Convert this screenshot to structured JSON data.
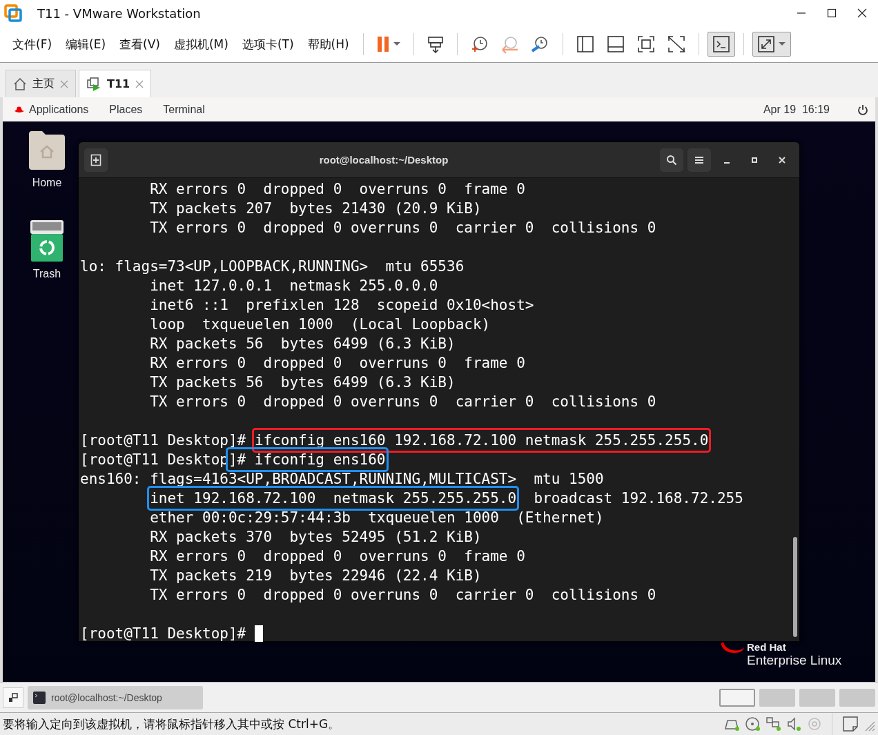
{
  "window": {
    "title": "T11 - VMware Workstation"
  },
  "menu": [
    "文件(F)",
    "编辑(E)",
    "查看(V)",
    "虚拟机(M)",
    "选项卡(T)",
    "帮助(H)"
  ],
  "tabs": [
    {
      "label": "主页",
      "kind": "home",
      "selected": false
    },
    {
      "label": "T11",
      "kind": "vm",
      "selected": true
    }
  ],
  "guest_top_bar": {
    "items": [
      "Applications",
      "Places",
      "Terminal"
    ],
    "clock": "Apr 19  16:19"
  },
  "desktop_icons": [
    {
      "label": "Home",
      "kind": "folder"
    },
    {
      "label": "Trash",
      "kind": "trash"
    }
  ],
  "branding": {
    "line_1": "Red Hat",
    "line_2": "Enterprise Linux"
  },
  "terminal": {
    "title": "root@localhost:~/Desktop",
    "lines": [
      {
        "segments": [
          {
            "text": "        RX errors 0  dropped 0  overruns 0  frame 0"
          }
        ]
      },
      {
        "segments": [
          {
            "text": "        TX packets 207  bytes 21430 (20.9 KiB)"
          }
        ]
      },
      {
        "segments": [
          {
            "text": "        TX errors 0  dropped 0 overruns 0  carrier 0  collisions 0"
          }
        ]
      },
      {
        "kind": "blank"
      },
      {
        "segments": [
          {
            "text": "lo: flags=73<UP,LOOPBACK,RUNNING>  mtu 65536"
          }
        ]
      },
      {
        "segments": [
          {
            "text": "        inet 127.0.0.1  netmask 255.0.0.0"
          }
        ]
      },
      {
        "segments": [
          {
            "text": "        inet6 ::1  prefixlen 128  scopeid 0x10<host>"
          }
        ]
      },
      {
        "segments": [
          {
            "text": "        loop  txqueuelen 1000  (Local Loopback)"
          }
        ]
      },
      {
        "segments": [
          {
            "text": "        RX packets 56  bytes 6499 (6.3 KiB)"
          }
        ]
      },
      {
        "segments": [
          {
            "text": "        RX errors 0  dropped 0  overruns 0  frame 0"
          }
        ]
      },
      {
        "segments": [
          {
            "text": "        TX packets 56  bytes 6499 (6.3 KiB)"
          }
        ]
      },
      {
        "segments": [
          {
            "text": "        TX errors 0  dropped 0 overruns 0  carrier 0  collisions 0"
          }
        ]
      },
      {
        "kind": "blank"
      },
      {
        "segments": [
          {
            "text": "[root@T11 Desktop]# "
          },
          {
            "text": "ifconfig ens160 192.168.72.100 netmask 255.255.255.0",
            "color": "#ee1c24"
          }
        ]
      },
      {
        "segments": [
          {
            "text": "[root@T11 Desktop"
          },
          {
            "text": "]# ifconfig ens160",
            "color": "#1f8ff0"
          }
        ]
      },
      {
        "segments": [
          {
            "text": "ens160: flags=4163<UP,BROADCAST,RUNNING,MULTICAST>  mtu 1500"
          }
        ]
      },
      {
        "indent": true,
        "segments": [
          {
            "text": "inet 192.168.72.100  netmask 255.255.255.0",
            "color": "#1f8ff0"
          },
          {
            "text": "  broadcast 192.168.72.255"
          }
        ]
      },
      {
        "segments": [
          {
            "text": "        ether 00:0c:29:57:44:3b  txqueuelen 1000  (Ethernet)"
          }
        ]
      },
      {
        "segments": [
          {
            "text": "        RX packets 370  bytes 52495 (51.2 KiB)"
          }
        ]
      },
      {
        "segments": [
          {
            "text": "        RX errors 0  dropped 0  overruns 0  frame 0"
          }
        ]
      },
      {
        "segments": [
          {
            "text": "        TX packets 219  bytes 22946 (22.4 KiB)"
          }
        ]
      },
      {
        "segments": [
          {
            "text": "        TX errors 0  dropped 0 overruns 0  carrier 0  collisions 0"
          }
        ]
      },
      {
        "kind": "blank"
      },
      {
        "kind": "prompt",
        "segments": [
          {
            "text": "[root@T11 Desktop]# "
          }
        ]
      }
    ]
  },
  "taskbar": {
    "task": "root@localhost:~/Desktop",
    "workspaces": [
      {
        "selected": true
      },
      {
        "selected": false
      },
      {
        "selected": false
      },
      {
        "selected": false
      }
    ]
  },
  "status_bar": {
    "message": "要将输入定向到该虚拟机，请将鼠标指针移入其中或按 Ctrl+G。"
  }
}
